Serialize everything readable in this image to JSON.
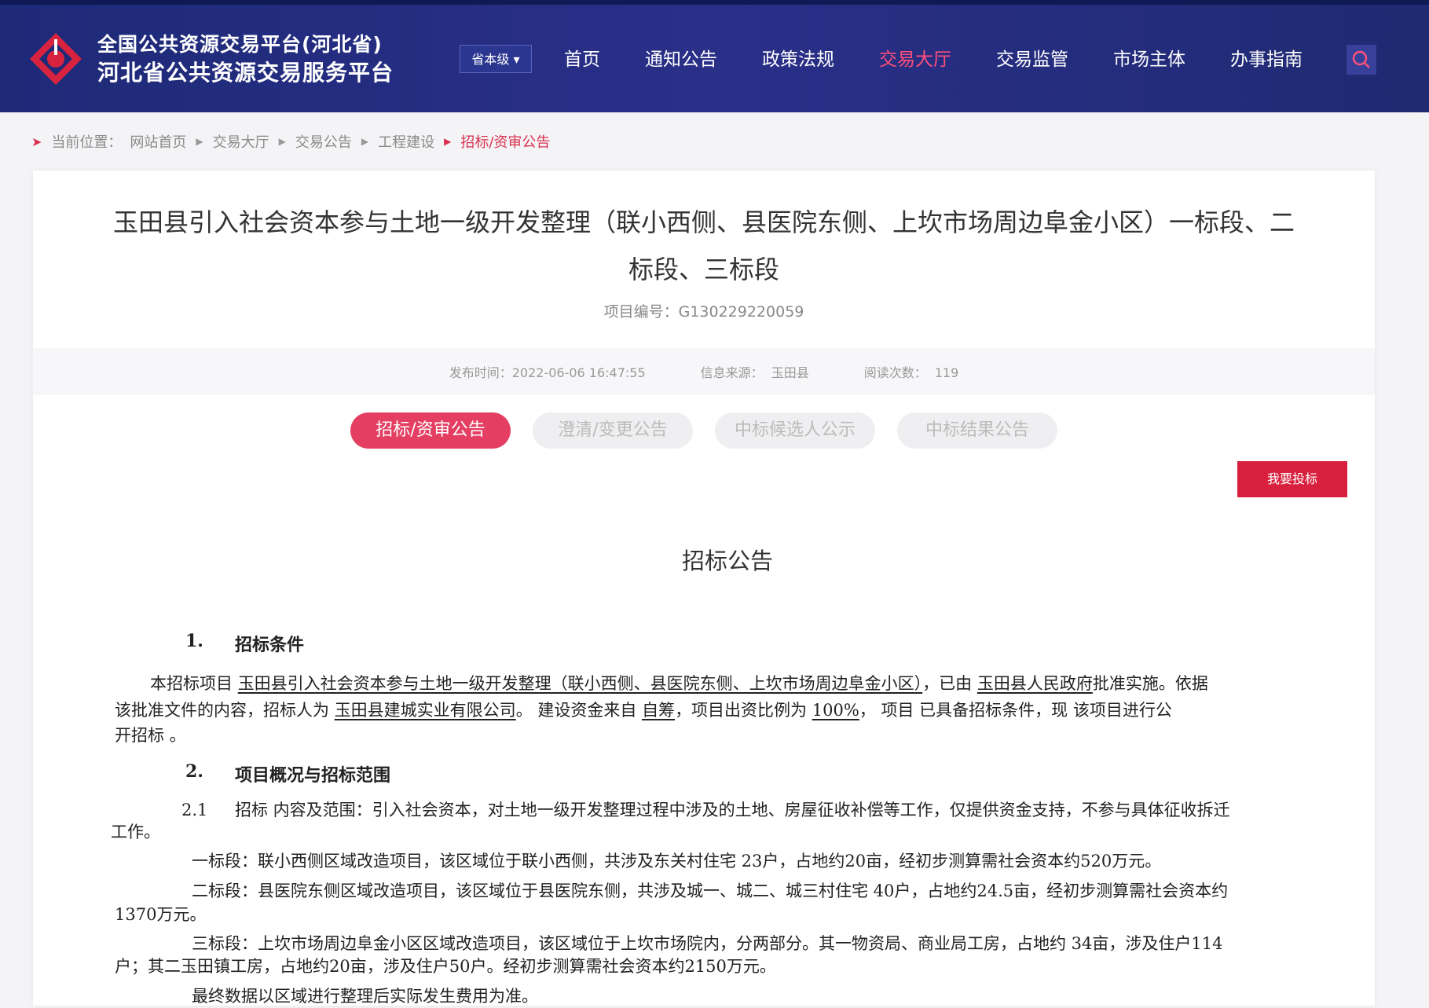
{
  "header": {
    "brand_line1": "全国公共资源交易平台(河北省)",
    "brand_line2": "河北省公共资源交易服务平台",
    "level_selector": "省本级",
    "nav": [
      "首页",
      "通知公告",
      "政策法规",
      "交易大厅",
      "交易监管",
      "市场主体",
      "办事指南"
    ],
    "active_nav_index": 3,
    "accent_color": "#ff4f7b"
  },
  "breadcrumb": {
    "label": "当前位置：",
    "items": [
      "网站首页",
      "交易大厅",
      "交易公告",
      "工程建设"
    ],
    "current": "招标/资审公告"
  },
  "article": {
    "title": "玉田县引入社会资本参与土地一级开发整理（联小西侧、县医院东侧、上坎市场周边阜金小区）一标段、二标段、三标段",
    "project_no": "项目编号：G130229220059",
    "publish_time": "发布时间：2022-06-06 16:47:55",
    "source_label": "信息来源：",
    "source_value": "玉田县",
    "reads_label": "阅读次数：",
    "reads_value": "119"
  },
  "tabs": [
    "招标/资审公告",
    "澄清/变更公告",
    "中标候选人公示",
    "中标结果公告"
  ],
  "bid_button": "我要投标",
  "doc": {
    "title": "招标公告",
    "sec1_no": "1.",
    "sec1_title": "招标条件",
    "p1_a": "本招标项目",
    "p1_project": "玉田县引入社会资本参与土地一级开发整理（联小西侧、县医院东侧、上坎市场周边阜金小区）",
    "p1_b": "，已由",
    "p1_approver": "玉田县人民政府",
    "p1_c": "批准实施。依据",
    "p2_a": "该批准文件的内容，招标人为",
    "p2_tenderer": "玉田县建城实业有限公司",
    "p2_b": "。 建设资金来自",
    "p2_fund": "自筹",
    "p2_c": "，项目出资比例为",
    "p2_ratio": "100%",
    "p2_d": "， 项目 已具备招标条件，现 该项目进行公",
    "p3": "开招标 。",
    "sec2_no": "2.",
    "sec2_title": "项目概况与招标范围",
    "p4_no": "2.1",
    "p4_a": "招标 内容及范围：引入社会资本，对土地一级开发整理过程中涉及的土地、房屋征收补偿等工作，仅提供资金支持，不参与具体征收拆迁",
    "p4_b": "工作。",
    "p5": "一标段：联小西侧区域改造项目，该区域位于联小西侧，共涉及东关村住宅 23户，占地约20亩，经初步测算需社会资本约520万元。",
    "p6_a": "二标段：县医院东侧区域改造项目，该区域位于县医院东侧，共涉及城一、城二、城三村住宅 40户，占地约24.5亩，经初步测算需社会资本约",
    "p6_b": "1370万元。",
    "p7_a": "三标段：上坎市场周边阜金小区区域改造项目，该区域位于上坎市场院内，分两部分。其一物资局、商业局工房，占地约 34亩，涉及住户114",
    "p7_b": "户；其二玉田镇工房，占地约20亩，涉及住户50户。经初步测算需社会资本约2150万元。",
    "p8": "最终数据以区域进行整理后实际发生费用为准。"
  }
}
